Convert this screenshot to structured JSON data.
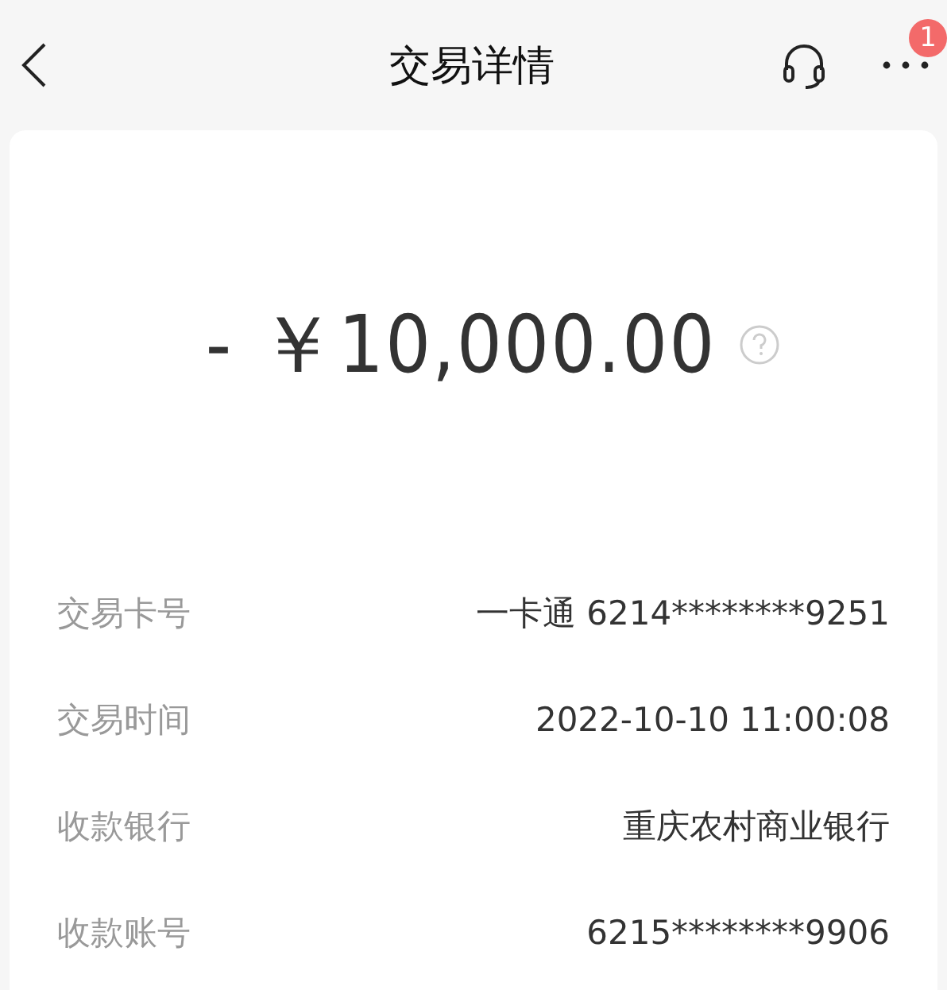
{
  "header": {
    "title": "交易详情",
    "badge": "1"
  },
  "amount": "- ￥10,000.00",
  "details": [
    {
      "label": "交易卡号",
      "value": "一卡通 6214********9251"
    },
    {
      "label": "交易时间",
      "value": "2022-10-10 11:00:08"
    },
    {
      "label": "收款银行",
      "value": "重庆农村商业银行"
    },
    {
      "label": "收款账号",
      "value": "6215********9906"
    }
  ]
}
